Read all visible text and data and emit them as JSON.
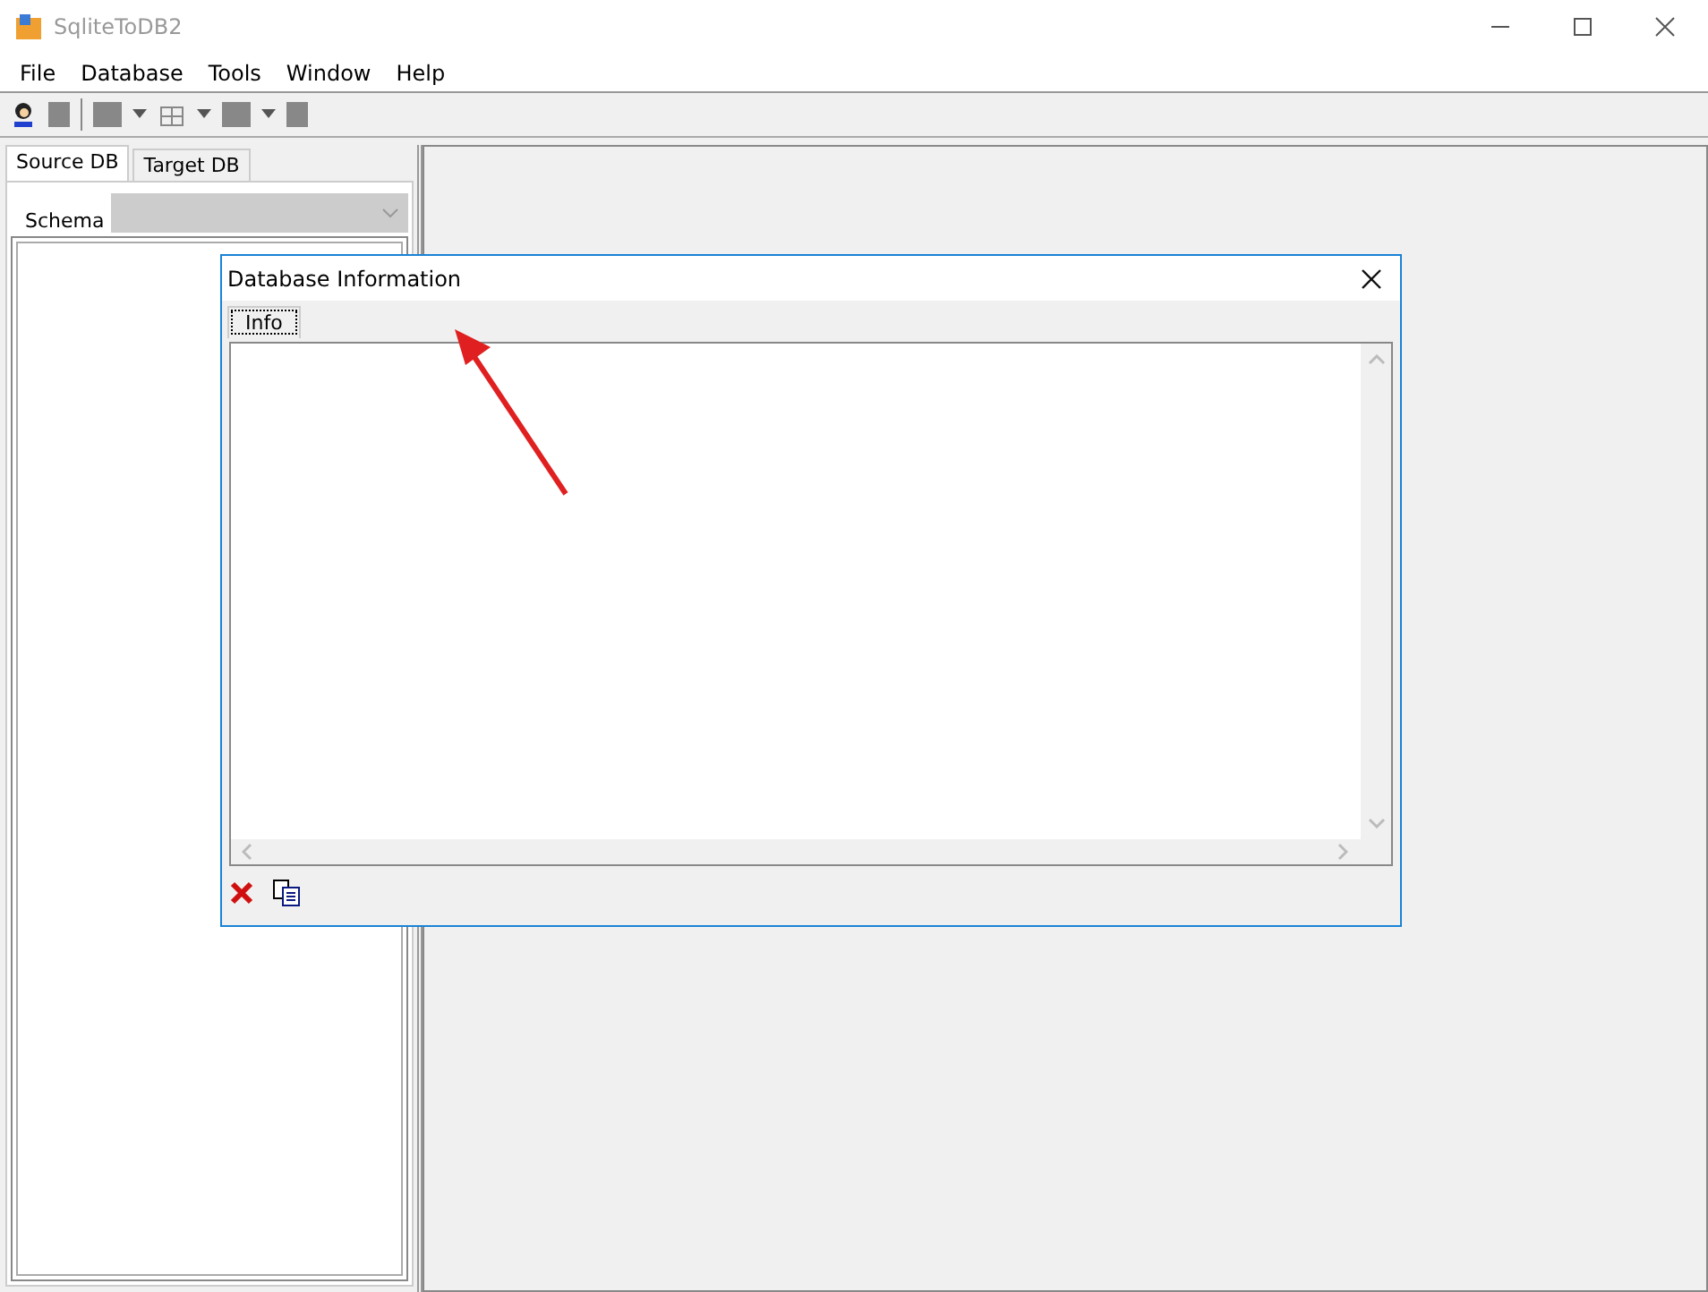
{
  "window": {
    "title": "SqliteToDB2"
  },
  "menu": [
    "File",
    "Database",
    "Tools",
    "Window",
    "Help"
  ],
  "left_panel": {
    "tabs": [
      {
        "label": "Source DB",
        "selected": true
      },
      {
        "label": "Target DB",
        "selected": false
      }
    ],
    "schema": {
      "label": "Schema",
      "disabled": true
    }
  },
  "dialog": {
    "title": "Database Information",
    "tabs": [
      {
        "label": "Info",
        "selected": true
      }
    ]
  }
}
